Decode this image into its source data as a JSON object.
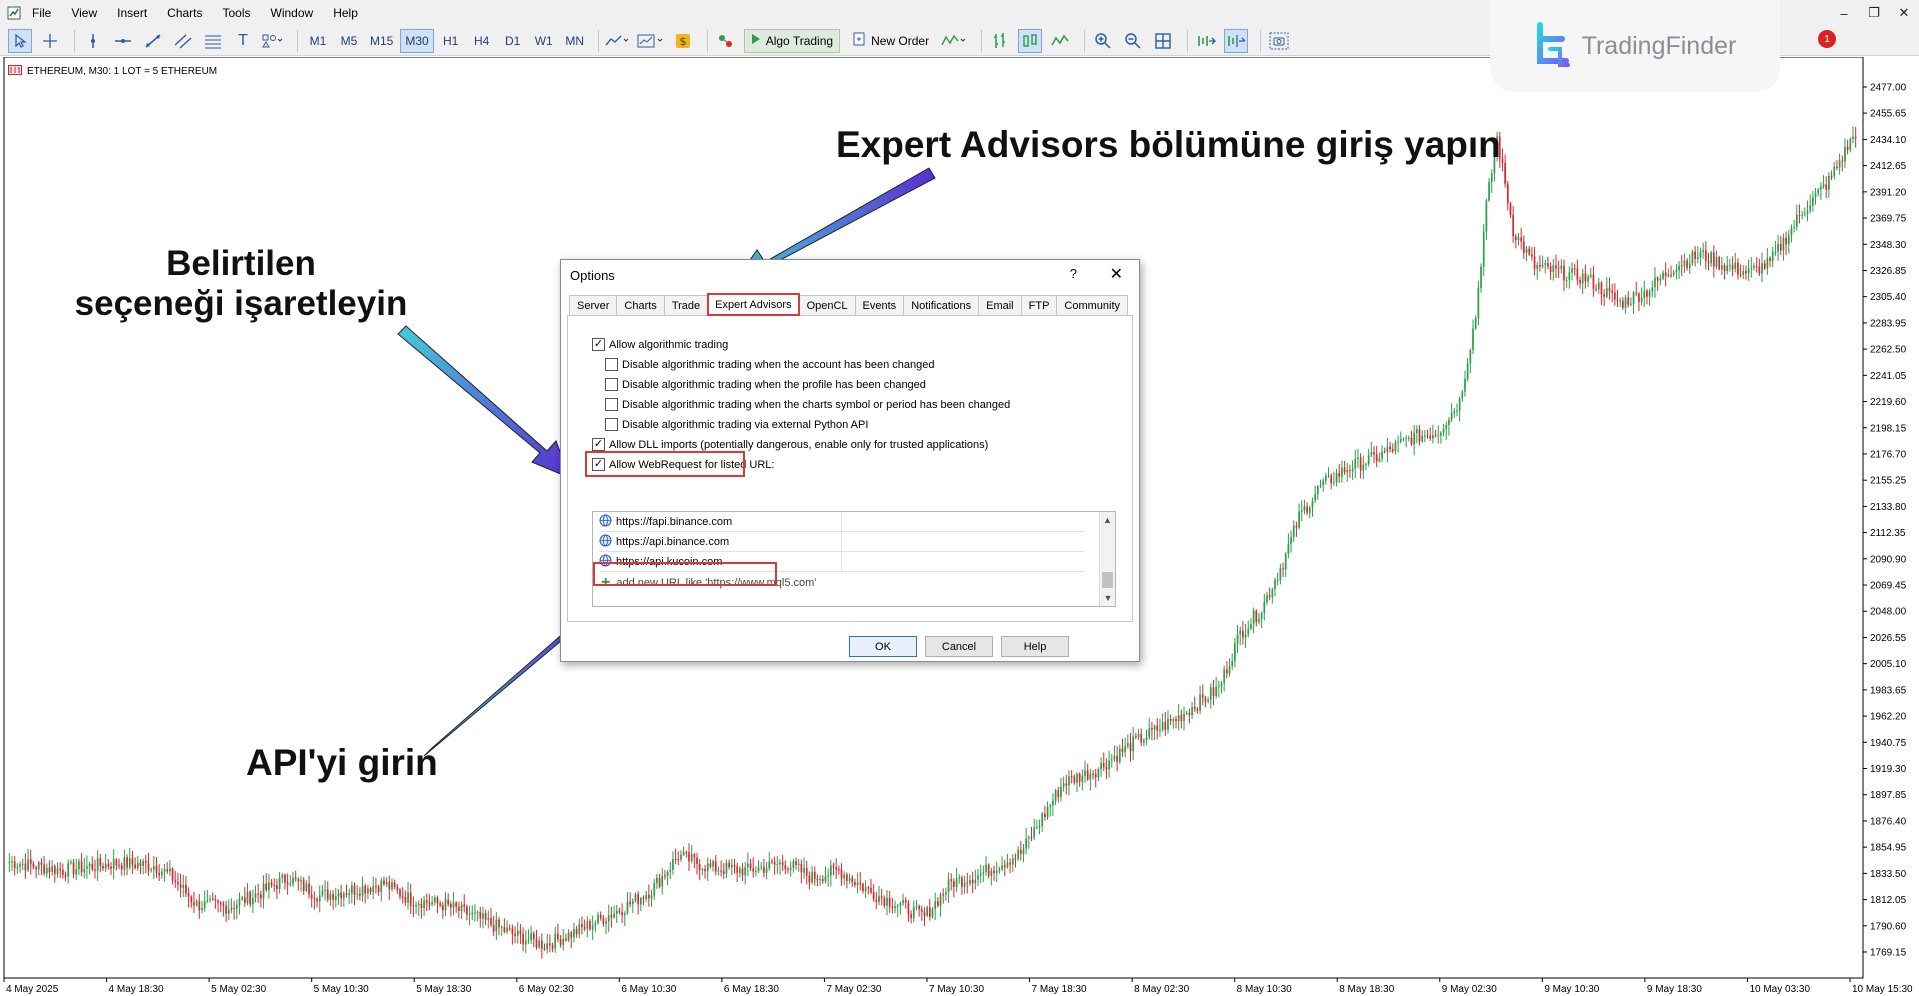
{
  "menu": [
    "File",
    "View",
    "Insert",
    "Charts",
    "Tools",
    "Window",
    "Help"
  ],
  "toolbar": {
    "timeframes": [
      "M1",
      "M5",
      "M15",
      "M30",
      "H1",
      "H4",
      "D1",
      "W1",
      "MN"
    ],
    "active_timeframe": "M30",
    "algo_trading": "Algo Trading",
    "new_order": "New Order"
  },
  "notification_count": "1",
  "watermark": "TradingFinder",
  "chart": {
    "label": "ETHEREUM, M30:  1 LOT = 5 ETHEREUM"
  },
  "chart_data": {
    "type": "candlestick",
    "symbol": "ETHEREUM",
    "timeframe": "M30",
    "y_ticks": [
      "2477.00",
      "2455.65",
      "2434.10",
      "2412.65",
      "2391.20",
      "2369.75",
      "2348.30",
      "2326.85",
      "2305.40",
      "2283.95",
      "2262.50",
      "2241.05",
      "2219.60",
      "2198.15",
      "2176.70",
      "2155.25",
      "2133.80",
      "2112.35",
      "2090.90",
      "2069.45",
      "2048.00",
      "2026.55",
      "2005.10",
      "1983.65",
      "1962.20",
      "1940.75",
      "1919.30",
      "1897.85",
      "1876.40",
      "1854.95",
      "1833.50",
      "1812.05",
      "1790.60",
      "1769.15"
    ],
    "x_ticks": [
      "4 May 2025",
      "4 May 18:30",
      "5 May 02:30",
      "5 May 10:30",
      "5 May 18:30",
      "6 May 02:30",
      "6 May 10:30",
      "6 May 18:30",
      "7 May 02:30",
      "7 May 10:30",
      "7 May 18:30",
      "8 May 02:30",
      "8 May 10:30",
      "8 May 18:30",
      "9 May 02:30",
      "9 May 10:30",
      "9 May 18:30",
      "10 May 03:30",
      "10 May 15:30"
    ],
    "ylim": [
      1758,
      2488
    ],
    "path_keypoints": [
      [
        0,
        1843
      ],
      [
        20,
        1836
      ],
      [
        40,
        1842
      ],
      [
        54,
        1840
      ],
      [
        60,
        1832
      ],
      [
        70,
        1808
      ],
      [
        82,
        1806
      ],
      [
        94,
        1818
      ],
      [
        104,
        1830
      ],
      [
        116,
        1815
      ],
      [
        128,
        1820
      ],
      [
        140,
        1825
      ],
      [
        150,
        1812
      ],
      [
        162,
        1808
      ],
      [
        172,
        1800
      ],
      [
        180,
        1792
      ],
      [
        190,
        1782
      ],
      [
        200,
        1775
      ],
      [
        212,
        1786
      ],
      [
        220,
        1795
      ],
      [
        230,
        1806
      ],
      [
        240,
        1820
      ],
      [
        250,
        1848
      ],
      [
        262,
        1838
      ],
      [
        276,
        1836
      ],
      [
        290,
        1842
      ],
      [
        300,
        1830
      ],
      [
        310,
        1836
      ],
      [
        322,
        1818
      ],
      [
        334,
        1806
      ],
      [
        342,
        1798
      ],
      [
        352,
        1826
      ],
      [
        362,
        1832
      ],
      [
        378,
        1850
      ],
      [
        394,
        1908
      ],
      [
        406,
        1918
      ],
      [
        420,
        1940
      ],
      [
        436,
        1960
      ],
      [
        452,
        1985
      ],
      [
        460,
        2030
      ],
      [
        468,
        2050
      ],
      [
        476,
        2088
      ],
      [
        482,
        2125
      ],
      [
        490,
        2150
      ],
      [
        500,
        2165
      ],
      [
        512,
        2175
      ],
      [
        524,
        2190
      ],
      [
        534,
        2195
      ],
      [
        542,
        2220
      ],
      [
        548,
        2290
      ],
      [
        552,
        2380
      ],
      [
        556,
        2435
      ],
      [
        562,
        2360
      ],
      [
        570,
        2330
      ],
      [
        580,
        2325
      ],
      [
        590,
        2320
      ],
      [
        602,
        2300
      ],
      [
        612,
        2310
      ],
      [
        622,
        2330
      ],
      [
        632,
        2340
      ],
      [
        642,
        2330
      ],
      [
        650,
        2325
      ],
      [
        658,
        2333
      ],
      [
        670,
        2375
      ],
      [
        680,
        2400
      ],
      [
        690,
        2440
      ]
    ]
  },
  "annotations": {
    "expert_advisors": "Expert Advisors bölümüne giriş yapın",
    "check_option_line1": "Belirtilen",
    "check_option_line2": "seçeneği işaretleyin",
    "enter_api": "API'yi girin"
  },
  "dialog": {
    "title": "Options",
    "help_glyph": "?",
    "close_glyph": "✕",
    "tabs": [
      "Server",
      "Charts",
      "Trade",
      "Expert Advisors",
      "OpenCL",
      "Events",
      "Notifications",
      "Email",
      "FTP",
      "Community"
    ],
    "active_tab": "Expert Advisors",
    "options": [
      {
        "label": "Allow algorithmic trading",
        "checked": true
      },
      {
        "label": "Disable algorithmic trading when the account has been changed",
        "checked": false
      },
      {
        "label": "Disable algorithmic trading when the profile has been changed",
        "checked": false
      },
      {
        "label": "Disable algorithmic trading when the charts symbol or period has been changed",
        "checked": false
      },
      {
        "label": "Disable algorithmic trading via external Python API",
        "checked": false
      },
      {
        "label": "Allow DLL imports (potentially dangerous, enable only for trusted applications)",
        "checked": true
      },
      {
        "label": "Allow WebRequest for listed URL:",
        "checked": true
      }
    ],
    "urls": [
      "https://fapi.binance.com",
      "https://api.binance.com",
      "https://api.kucoin.com"
    ],
    "add_url_placeholder": "add new URL like 'https://www.mql5.com'",
    "buttons": {
      "ok": "OK",
      "cancel": "Cancel",
      "help": "Help"
    }
  },
  "colors": {
    "bull": "#2a9d48",
    "bear": "#d8272e",
    "highlight": "#d63a3a",
    "arrow_start": "#45c8d8",
    "arrow_end": "#5a2fd0"
  }
}
